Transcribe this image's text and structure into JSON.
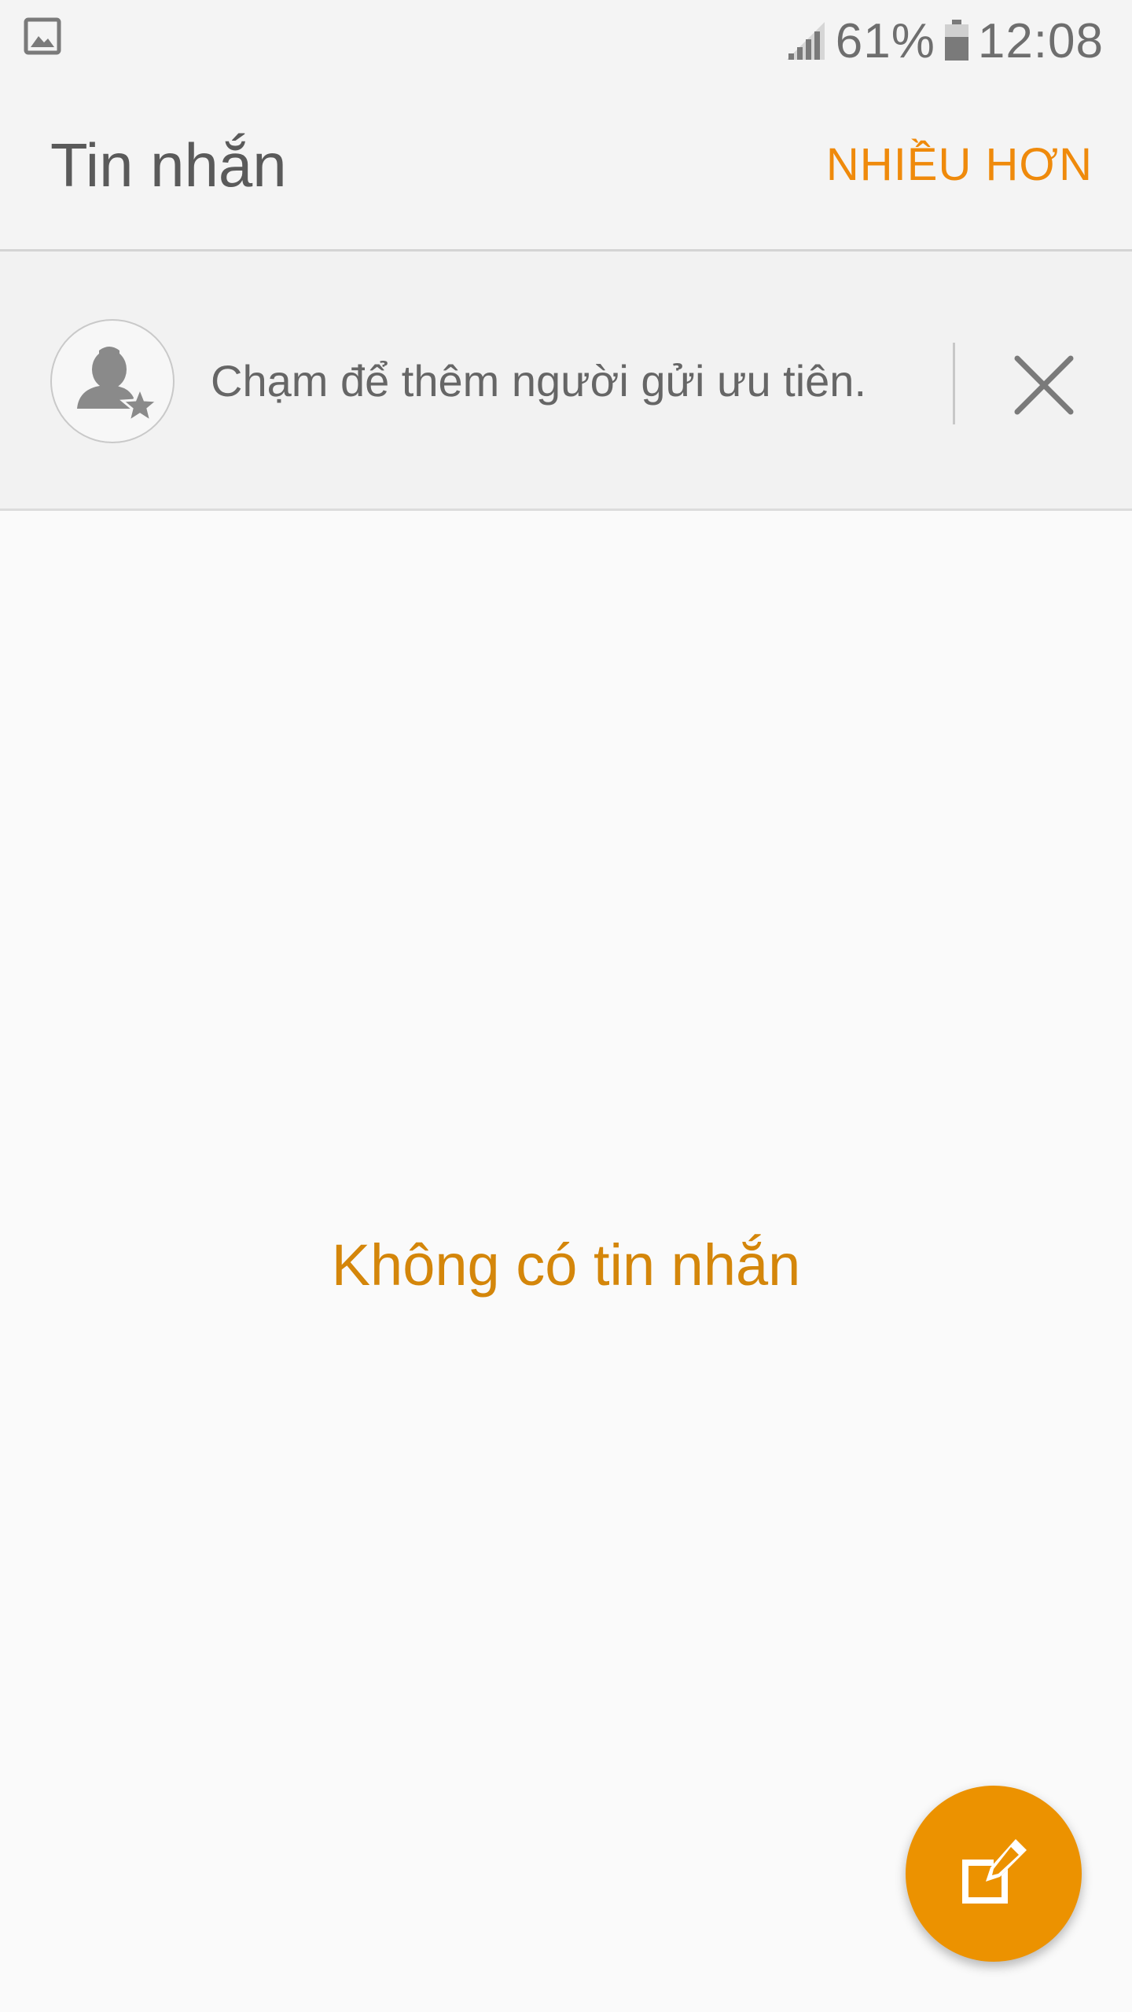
{
  "status_bar": {
    "battery_percent": "61%",
    "time": "12:08",
    "icons": [
      "image-notification-icon",
      "signal-icon",
      "battery-icon"
    ]
  },
  "app_bar": {
    "title": "Tin nhắn",
    "more_label": "NHIỀU HƠN"
  },
  "priority_banner": {
    "text": "Chạm để thêm người gửi ưu tiên.",
    "icons": [
      "priority-contact-icon",
      "close-icon"
    ]
  },
  "empty_state": {
    "message": "Không có tin nhắn"
  },
  "fab": {
    "icon": "compose-icon"
  },
  "colors": {
    "accent": "#ef8a0b",
    "empty_text": "#d4860a",
    "fab": "#ec9200",
    "status_text": "#6e6e6e",
    "background": "#fafafa"
  }
}
